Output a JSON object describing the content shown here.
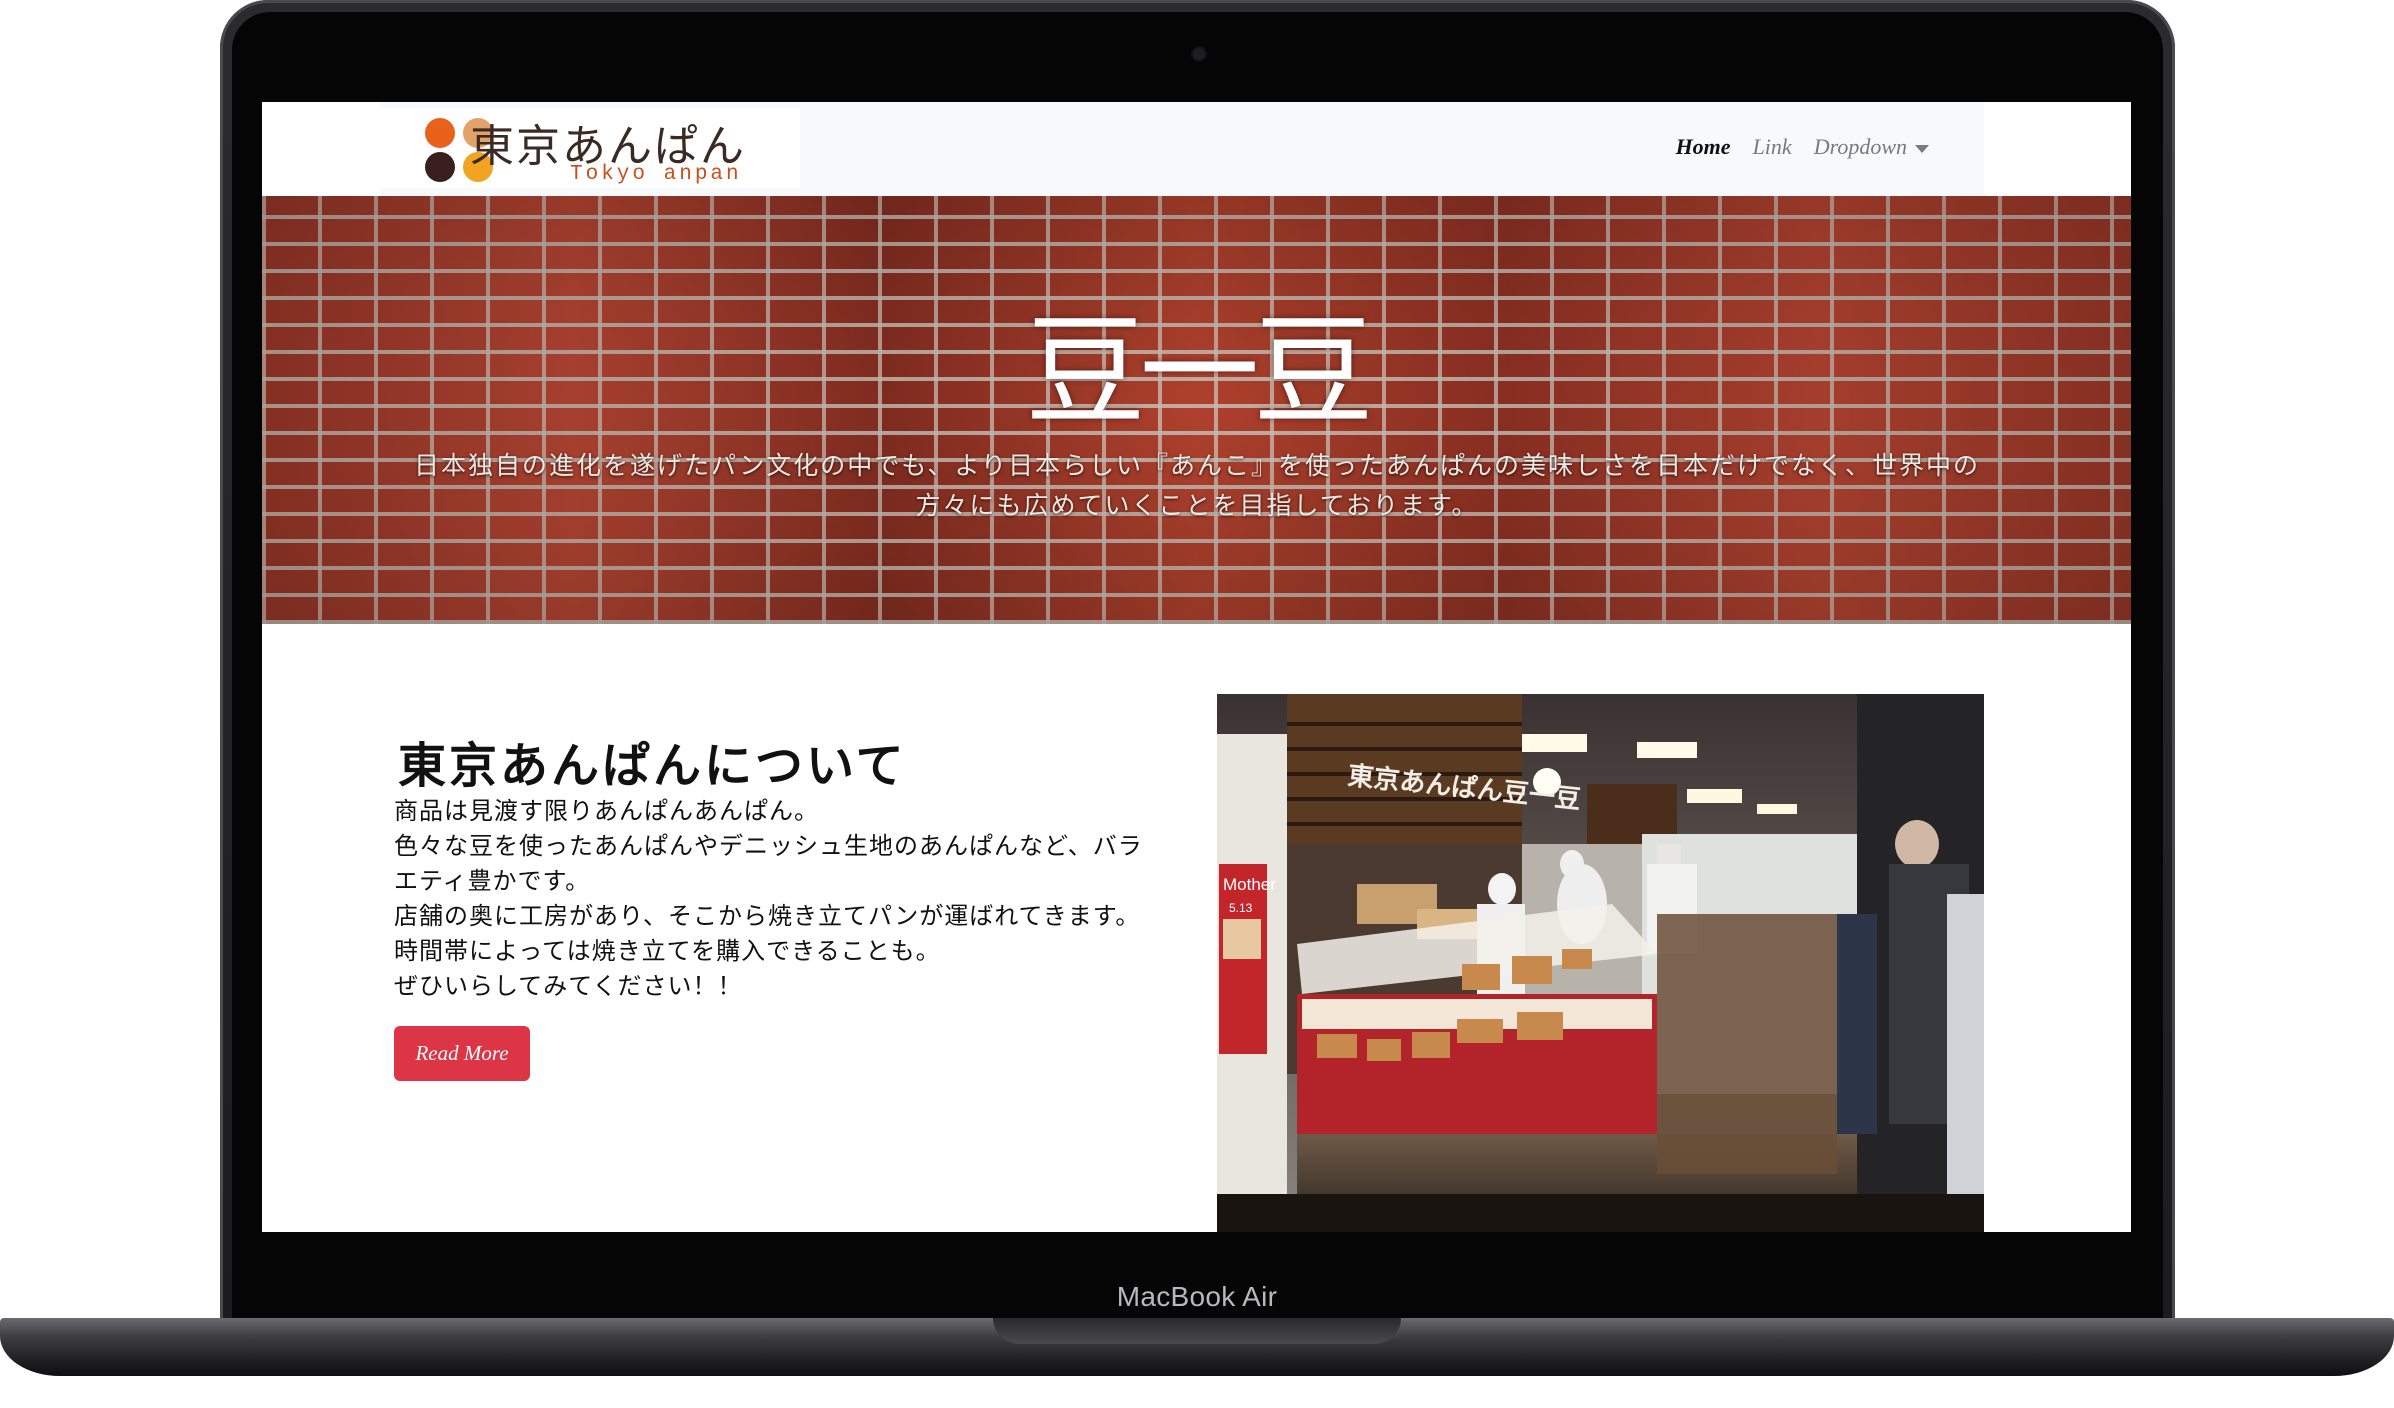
{
  "device": {
    "label": "MacBook Air"
  },
  "logo": {
    "text_jp": "東京あんぱん",
    "text_en": "Tokyo anpan",
    "dot_colors": [
      "#e9621c",
      "#e3a26a",
      "#3a1f1f",
      "#f0a420"
    ]
  },
  "nav": {
    "items": [
      {
        "label": "Home"
      },
      {
        "label": "Link"
      },
      {
        "label": "Dropdown"
      }
    ]
  },
  "hero": {
    "title": "豆一豆",
    "text": "日本独自の進化を遂げたパン文化の中でも、より日本らしい『あんこ』を使ったあんぱんの美味しさを日本だけでなく、世界中の方々にも広めていくことを目指しております。"
  },
  "about": {
    "title": "東京あんぱんについて",
    "lines": [
      "商品は見渡す限りあんぱんあんぱん。",
      "色々な豆を使ったあんぱんやデニッシュ生地のあんぱんなど、バラエティ豊かです。",
      "店舗の奥に工房があり、そこから焼き立てパンが運ばれてきます。",
      "時間帯によっては焼き立てを購入できることも。",
      "ぜひいらしてみてください！！"
    ],
    "button_label": "Read More"
  },
  "photo": {
    "sign_text": "東京あんぱん豆一豆",
    "poster_text": "Mother",
    "poster_date": "5.13"
  },
  "colors": {
    "accent_button": "#dc3545",
    "navbar_bg": "#f8f9fa",
    "brick": "#b8442f"
  }
}
